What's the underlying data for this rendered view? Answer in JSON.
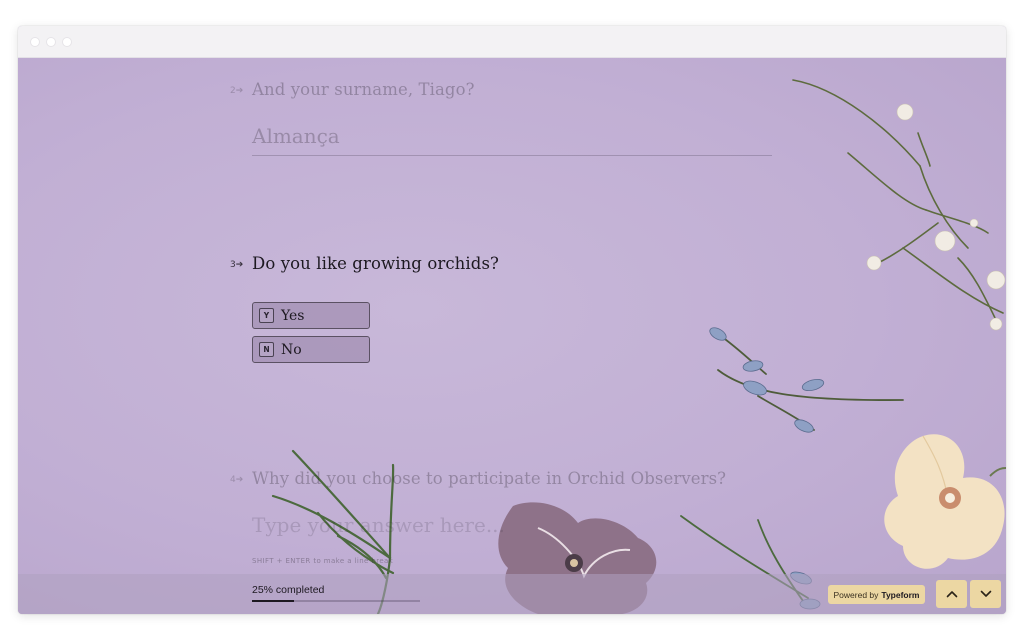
{
  "browser": {
    "window_controls": [
      "close-dot",
      "minimize-dot",
      "maximize-dot"
    ]
  },
  "form": {
    "questions": [
      {
        "number": "2",
        "arrow": "➔",
        "text": "And your surname, Tiago?",
        "answer": "Almança",
        "state": "previous"
      },
      {
        "number": "3",
        "arrow": "➔",
        "text": "Do you like growing orchids?",
        "state": "active",
        "choices": [
          {
            "key": "Y",
            "label": "Yes"
          },
          {
            "key": "N",
            "label": "No"
          }
        ]
      },
      {
        "number": "4",
        "arrow": "➔",
        "text": "Why did you choose to participate in Orchid Observers?",
        "placeholder": "Type your answer here...",
        "hint": "SHIFT + ENTER to make a line break",
        "state": "next"
      }
    ]
  },
  "footer": {
    "progress_label": "25% completed",
    "progress_fraction": 0.25,
    "powered_prefix": "Powered by",
    "powered_brand": "Typeform",
    "up_icon": "chevron-up-icon",
    "down_icon": "chevron-down-icon"
  },
  "colors": {
    "background": "#c3b1d5",
    "accent_button": "#ecd7a3",
    "text": "#1d1921"
  }
}
